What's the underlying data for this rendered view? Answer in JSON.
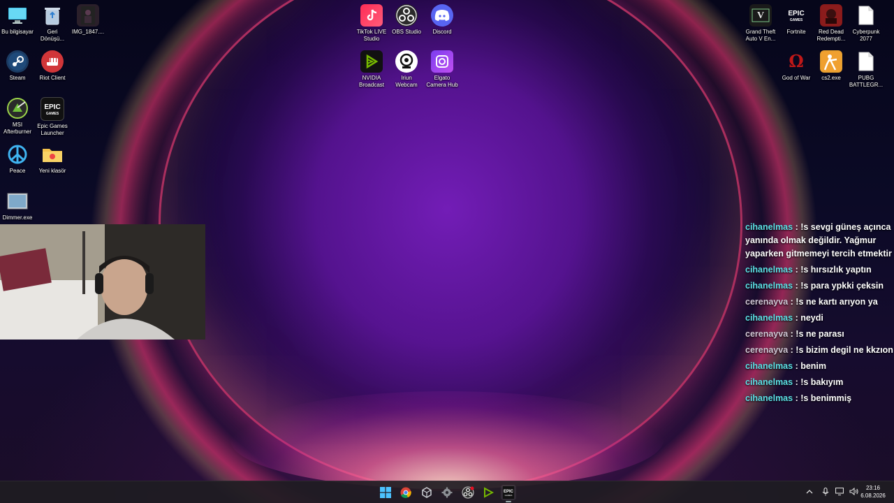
{
  "desktop_icons": {
    "left": [
      {
        "label": "Bu bilgisayar"
      },
      {
        "label": "Geri\nDönüşü..."
      },
      {
        "label": "IMG_1847...."
      },
      {
        "label": "Steam"
      },
      {
        "label": "Riot Client"
      },
      {
        "label": "MSI\nAfterburner"
      },
      {
        "label": "Epic Games\nLauncher"
      },
      {
        "label": "Peace"
      },
      {
        "label": "Yeni klasör"
      },
      {
        "label": "Dimmer.exe"
      }
    ],
    "center": [
      {
        "label": "TikTok LIVE\nStudio"
      },
      {
        "label": "OBS Studio"
      },
      {
        "label": "Discord"
      },
      {
        "label": "NVIDIA\nBroadcast"
      },
      {
        "label": "Iriun\nWebcam"
      },
      {
        "label": "Elgato\nCamera Hub"
      }
    ],
    "right": [
      {
        "label": "Grand Theft\nAuto V En..."
      },
      {
        "label": "Fortnite"
      },
      {
        "label": "Red Dead\nRedempti..."
      },
      {
        "label": "Cyberpunk\n2077"
      },
      {
        "label": "God of War"
      },
      {
        "label": "cs2.exe"
      },
      {
        "label": "PUBG\nBATTLEGR..."
      }
    ]
  },
  "chat": {
    "messages": [
      {
        "user": "cihanelmas",
        "text": " : !s sevgi güneş açınca yanında olmak değildir. Yağmur yaparken gitmemeyi tercih etmektir",
        "user_style": "a"
      },
      {
        "user": "cihanelmas",
        "text": " : !s hırsızlık yaptın",
        "user_style": "a"
      },
      {
        "user": "cihanelmas",
        "text": " : !s para ypkki çeksin",
        "user_style": "a"
      },
      {
        "user": "cerenayva",
        "text": " : !s ne kartı arıyon ya",
        "user_style": "b"
      },
      {
        "user": "cihanelmas",
        "text": " : neydi",
        "user_style": "a"
      },
      {
        "user": "cerenayva",
        "text": " : !s ne parası",
        "user_style": "b"
      },
      {
        "user": "cerenayva",
        "text": " : !s bizim degil ne kkzıon",
        "user_style": "b"
      },
      {
        "user": "cihanelmas",
        "text": " : benim",
        "user_style": "a"
      },
      {
        "user": "cihanelmas",
        "text": " : !s bakıyım",
        "user_style": "a"
      },
      {
        "user": "cihanelmas",
        "text": " : !s benimmiş",
        "user_style": "a"
      }
    ]
  },
  "taskbar": {
    "time": "23:16",
    "date": "6.08.2026"
  },
  "colors": {
    "chat_user_a": "#5ce1e6",
    "chat_user_b": "#d0c6d4",
    "taskbar_bg": "#1e1c22"
  }
}
